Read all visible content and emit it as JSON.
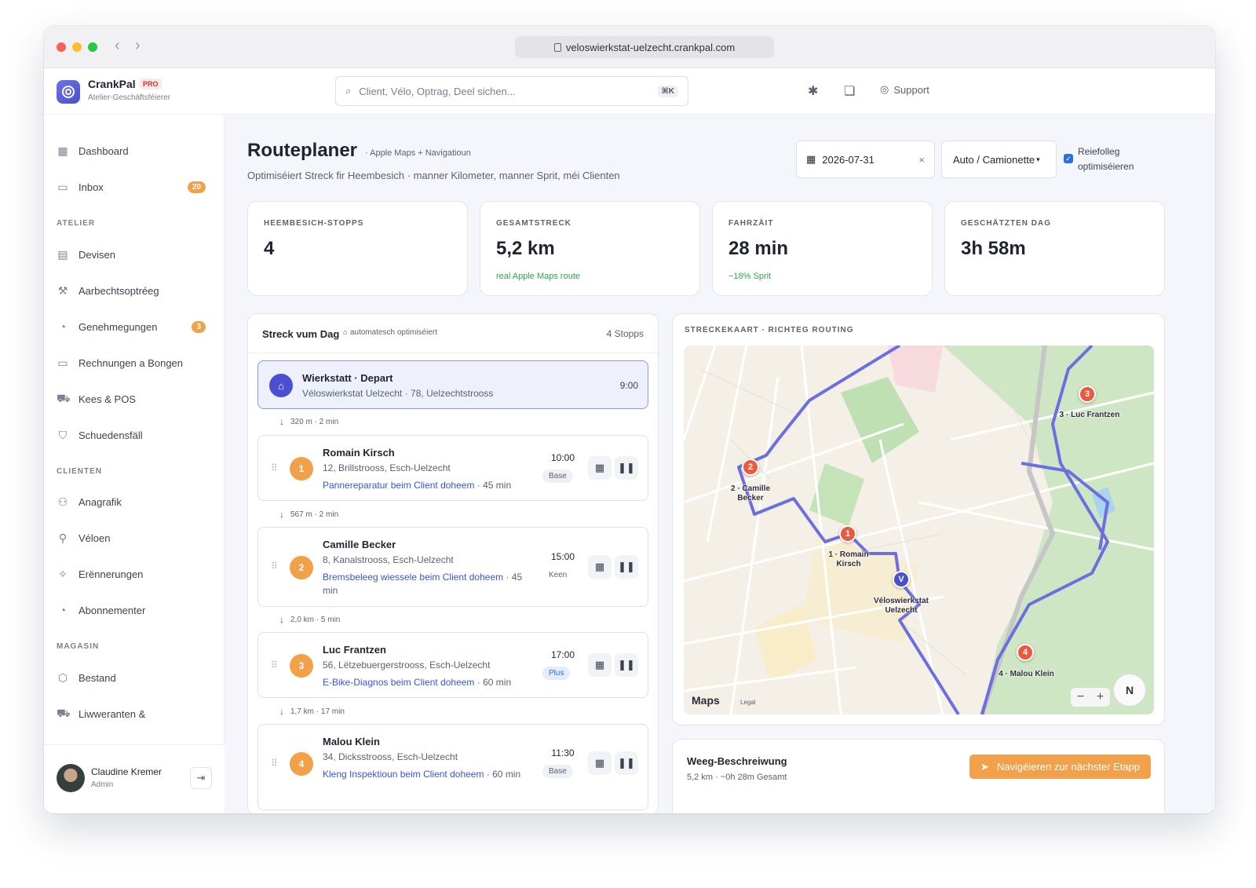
{
  "browser": {
    "url": "veloswierkstat-uelzecht.crankpal.com"
  },
  "brand": {
    "name": "CrankPal",
    "badge": "PRO",
    "subtitle": "Atelier-Geschäftsféierer"
  },
  "search": {
    "placeholder": "Client, Vélo, Optrag, Deel sichen...",
    "shortcut": "⌘K"
  },
  "topbar": {
    "support_label": "Support"
  },
  "sidebar": {
    "items_top": [
      {
        "label": "Dashboard",
        "icon": "grid-icon"
      },
      {
        "label": "Inbox",
        "icon": "inbox-icon",
        "badge": "20"
      }
    ],
    "section_atelier": "ATELIER",
    "items_atelier": [
      {
        "label": "Devisen",
        "icon": "document-icon"
      },
      {
        "label": "Aarbechtsoptréeg",
        "icon": "wrench-icon"
      },
      {
        "label": "Genehmegungen",
        "icon": "check-circle-icon",
        "badge": "3"
      },
      {
        "label": "Rechnungen a Bongen",
        "icon": "receipt-icon"
      },
      {
        "label": "Kees & POS",
        "icon": "cart-icon"
      },
      {
        "label": "Schuedensfäll",
        "icon": "shield-icon"
      }
    ],
    "section_clienten": "CLIENTEN",
    "items_clienten": [
      {
        "label": "Anagrafik",
        "icon": "users-icon"
      },
      {
        "label": "Véloen",
        "icon": "bike-icon"
      },
      {
        "label": "Erënnerungen",
        "icon": "sparkle-icon"
      },
      {
        "label": "Abonnementer",
        "icon": "check-circle-icon"
      }
    ],
    "section_magasin": "MAGASIN",
    "items_magasin": [
      {
        "label": "Bestand",
        "icon": "box-icon"
      },
      {
        "label": "Liwweranten &",
        "icon": "truck-icon"
      }
    ],
    "user": {
      "name": "Claudine Kremer",
      "role": "Admin"
    }
  },
  "page": {
    "title": "Routeplaner",
    "tag": "· Apple Maps + Navigatioun",
    "subtitle": "Optimiséiert Streck fir Heembesich · manner Kilometer, manner Sprit, méi Clienten",
    "date": "2026-07-31",
    "vehicle": "Auto / Camionette",
    "optimize_label": "Reiefolleg optimiséieren"
  },
  "stats": [
    {
      "label": "HEEMBESICH-STOPPS",
      "value": "4",
      "note": ""
    },
    {
      "label": "GESAMTSTRECK",
      "value": "5,2 km",
      "note": "real Apple Maps route"
    },
    {
      "label": "FAHRZÄIT",
      "value": "28 min",
      "note": "−18% Sprit"
    },
    {
      "label": "GESCHÄTZTEN DAG",
      "value": "3h 58m",
      "note": ""
    }
  ],
  "route": {
    "title": "Streck vum Dag",
    "auto_label": "automatesch optimiséiert",
    "count": "4 Stopps",
    "depot": {
      "name": "Wierkstatt · Depart",
      "address": "Véloswierkstat Uelzecht · 78, Uelzechtstrooss",
      "time": "9:00"
    },
    "legs": [
      "320 m · 2 min",
      "567 m · 2 min",
      "2,0 km · 5 min",
      "1,7 km · 17 min"
    ],
    "stops": [
      {
        "num": "1",
        "name": "Romain Kirsch",
        "address": "12, Brillstrooss, Esch-Uelzecht",
        "task": "Pannereparatur beim Client doheem",
        "duration": " · 45 min",
        "time": "10:00",
        "tier": "Base"
      },
      {
        "num": "2",
        "name": "Camille Becker",
        "address": "8, Kanalstrooss, Esch-Uelzecht",
        "task": "Bremsbeleeg wiessele beim Client doheem",
        "duration": " · 45 min",
        "time": "15:00",
        "tier": "Keen"
      },
      {
        "num": "3",
        "name": "Luc Frantzen",
        "address": "56, Lëtzebuergerstrooss, Esch-Uelzecht",
        "task": "E-Bike-Diagnos beim Client doheem",
        "duration": " · 60 min",
        "time": "17:00",
        "tier": "Plus"
      },
      {
        "num": "4",
        "name": "Malou Klein",
        "address": "34, Dicksstrooss, Esch-Uelzecht",
        "task": "Kleng Inspektioun beim Client doheem",
        "duration": " · 60 min",
        "time": "11:30",
        "tier": "Base"
      }
    ]
  },
  "map": {
    "label": "STRECKEKAART · RICHTEG ROUTING",
    "pins": [
      {
        "mark": "1",
        "label1": "1 · Romain",
        "label2": "Kirsch"
      },
      {
        "mark": "2",
        "label1": "2 · Camille",
        "label2": "Becker"
      },
      {
        "mark": "3",
        "label1": "3 · Luc Frantzen",
        "label2": ""
      },
      {
        "mark": "4",
        "label1": "4 · Malou Klein",
        "label2": ""
      },
      {
        "mark": "V",
        "label1": "Véloswierkstat",
        "label2": "Uelzecht"
      }
    ],
    "brand": "Maps",
    "legal": "Legal",
    "compass": "N",
    "route_color": "#6c70de"
  },
  "directions": {
    "title": "Weeg-Beschreiwung",
    "subtitle": "5,2 km · ~0h 28m Gesamt",
    "button": "Navigéieren zur nächster Etapp"
  }
}
